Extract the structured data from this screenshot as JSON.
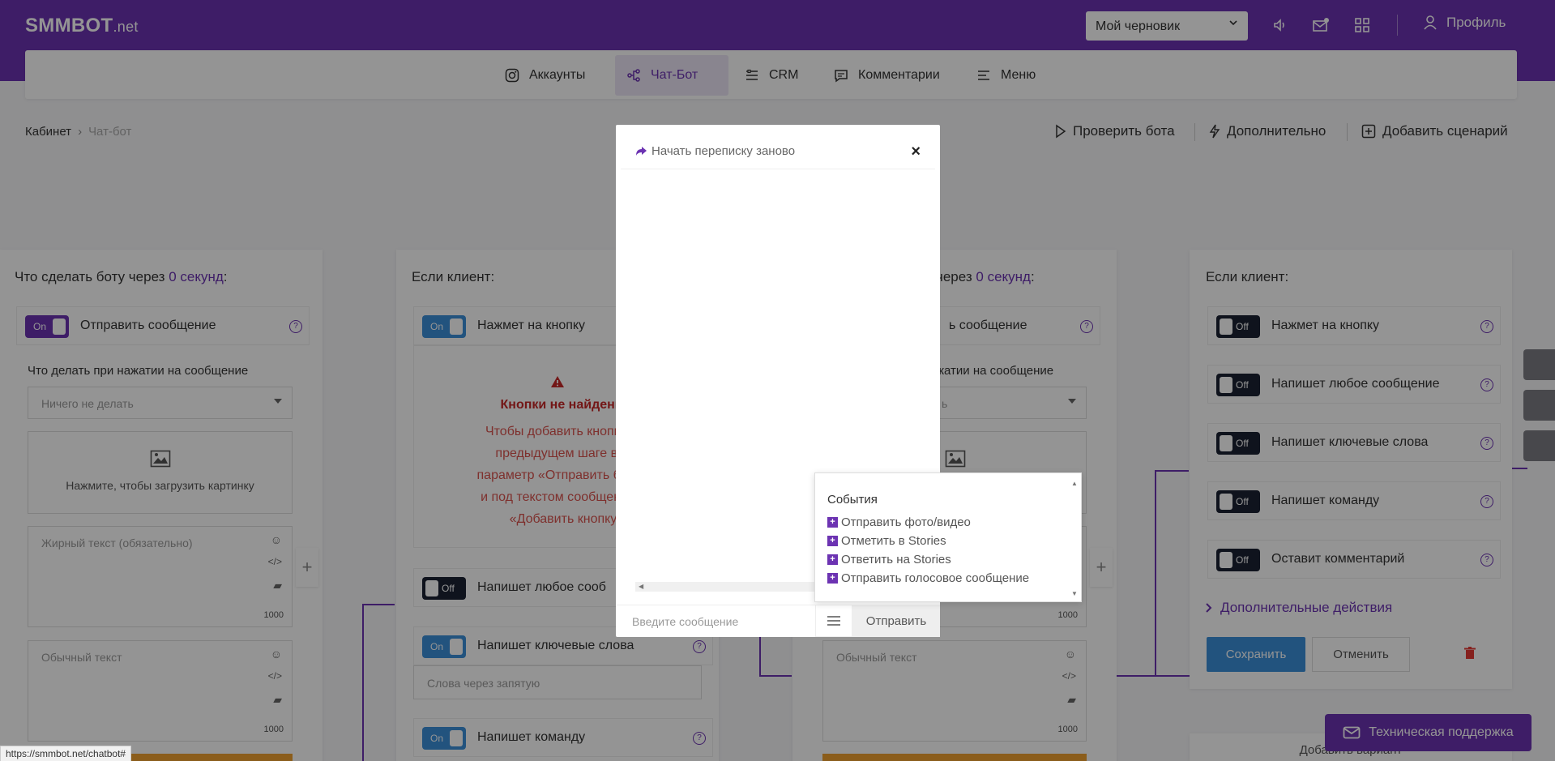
{
  "header": {
    "logo_main": "SMMBOT",
    "logo_tld": ".net",
    "draft_select": "Мой черновик",
    "profile": "Профиль"
  },
  "nav": {
    "accounts": "Аккаунты",
    "chatbot": "Чат-Бот",
    "crm": "CRM",
    "comments": "Комментарии",
    "menu": "Меню"
  },
  "breadcrumb": {
    "home": "Кабинет",
    "current": "Чат-бот"
  },
  "actions": {
    "check_bot": "Проверить бота",
    "more": "Дополнительно",
    "add_scenario": "Добавить сценарий"
  },
  "card1": {
    "title_prefix": "Что сделать боту через",
    "title_accent": "0 секунд",
    "title_suffix": ":",
    "toggle": "On",
    "send_message": "Отправить сообщение",
    "on_click_label": "Что делать при нажатии на сообщение",
    "on_click_value": "Ничего не делать",
    "upload_image": "Нажмите, чтобы загрузить картинку",
    "bold_placeholder": "Жирный текст (обязательно)",
    "bold_counter": "1000",
    "normal_placeholder": "Обычный текст",
    "normal_counter": "1000"
  },
  "card2": {
    "title": "Если клиент:",
    "click_toggle": "On",
    "click_label": "Нажмет на кнопку",
    "warn_title": "Кнопки не найдены",
    "warn_l1": "Чтобы добавить кнопки, в",
    "warn_l2": "предыдущем шаге вкл",
    "warn_l3": "параметр «Отправить быстр",
    "warn_l4": "и под текстом сообщения н",
    "warn_l5": "«Добавить кнопку",
    "any_toggle": "Off",
    "any_label": "Напишет любое сооб",
    "kw_toggle": "On",
    "kw_label": "Напишет ключевые слова",
    "kw_placeholder": "Слова через запятую",
    "cmd_toggle": "On",
    "cmd_label": "Напишет команду"
  },
  "card3": {
    "title_prefix": "через",
    "title_accent": "0 секунд",
    "title_suffix": ":",
    "send_message": "ь сообщение",
    "on_click_label": "жатии на сообщение",
    "on_click_value": "ь",
    "counter1": "1000",
    "normal_placeholder": "Обычный текст",
    "counter2": "1000"
  },
  "card4": {
    "title": "Если клиент:",
    "items": [
      {
        "toggle": "Off",
        "label": "Нажмет на кнопку"
      },
      {
        "toggle": "Off",
        "label": "Напишет любое сообщение"
      },
      {
        "toggle": "Off",
        "label": "Напишет ключевые слова"
      },
      {
        "toggle": "Off",
        "label": "Напишет команду"
      },
      {
        "toggle": "Off",
        "label": "Оставит комментарий"
      }
    ],
    "more_actions": "Дополнительные действия",
    "save": "Сохранить",
    "cancel": "Отменить",
    "add_variant": "Добавить вариант"
  },
  "modal": {
    "restart": "Начать переписку заново",
    "close": "×",
    "input_placeholder": "Введите сообщение",
    "send": "Отправить"
  },
  "events": {
    "title": "События",
    "items": [
      "Отправить фото/видео",
      "Отметить в Stories",
      "Ответить на Stories",
      "Отправить голосовое сообщение"
    ]
  },
  "support": "Техническая поддержка",
  "status_url": "https://smmbot.net/chatbot#",
  "colors": {
    "brand": "#6c33b2",
    "blue": "#3b8fd9",
    "danger": "#d32f2f",
    "orange": "#f0a030"
  }
}
